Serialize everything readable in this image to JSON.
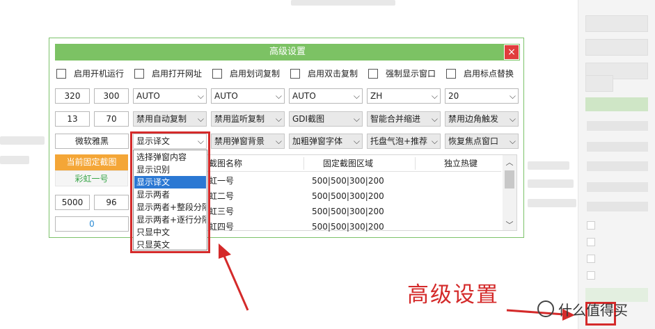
{
  "dialog": {
    "title": "高级设置",
    "close_icon": "×",
    "checkboxes": [
      {
        "label": "启用开机运行",
        "checked": false
      },
      {
        "label": "启用打开网址",
        "checked": false
      },
      {
        "label": "启用划词复制",
        "checked": false
      },
      {
        "label": "启用双击复制",
        "checked": false
      },
      {
        "label": "强制显示窗口",
        "checked": false
      },
      {
        "label": "启用标点替换",
        "checked": false
      }
    ],
    "row1": {
      "num_a": "320",
      "num_b": "300",
      "selects": [
        "AUTO",
        "AUTO",
        "AUTO",
        "ZH",
        "20"
      ]
    },
    "row2": {
      "num_a": "13",
      "num_b": "70",
      "selects": [
        "禁用自动复制",
        "禁用监听复制",
        "GDI截图",
        "智能合并缩进",
        "禁用边角触发"
      ]
    },
    "row3": {
      "font_button": "微软雅黑",
      "selects": [
        "显示译文",
        "禁用弹窗背景",
        "加粗弹窗字体",
        "托盘气泡+推荐",
        "恢复焦点窗口"
      ]
    },
    "left_panel": {
      "current_fixed_btn": "当前固定截图",
      "rainbow_label": "彩虹一号",
      "num_a": "5000",
      "num_b": "96",
      "counter": "0"
    },
    "table": {
      "headers": [
        "截图名称",
        "固定截图区域",
        "独立热键"
      ],
      "rows": [
        {
          "name": "虹一号",
          "area": "500|500|300|200",
          "hotkey": ""
        },
        {
          "name": "虹二号",
          "area": "500|500|300|200",
          "hotkey": ""
        },
        {
          "name": "虹三号",
          "area": "500|500|300|200",
          "hotkey": ""
        },
        {
          "name": "虹四号",
          "area": "500|500|300|200",
          "hotkey": ""
        }
      ]
    },
    "dropdown_options": [
      "选择弹窗内容",
      "显示识别",
      "显示译文",
      "显示两者",
      "显示两者+整段分隔",
      "显示两者+逐行分隔",
      "只显中文",
      "只显英文"
    ],
    "dropdown_selected": "显示译文"
  },
  "annotation": "高级设置",
  "watermark": "什么值得买",
  "colors": {
    "title_green": "#7cc264",
    "close_red": "#e13d3d",
    "accent_orange": "#f4a637",
    "highlight_blue": "#2b78d3",
    "annotation_red": "#d42a2a"
  }
}
